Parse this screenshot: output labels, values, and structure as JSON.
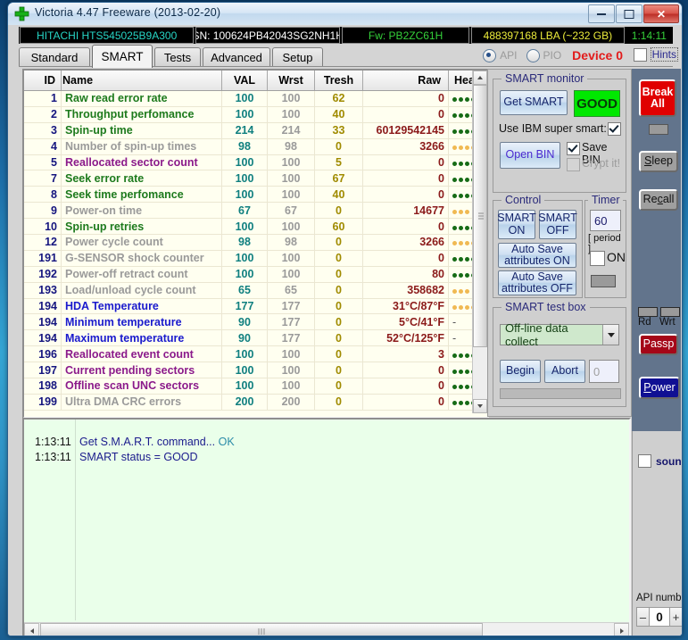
{
  "window": {
    "title": "Victoria 4.47  Freeware (2013-02-20)",
    "icon": "green-cross-icon",
    "minimize": "minimize-icon",
    "maximize": "maximize-icon",
    "close": "close-icon"
  },
  "drive_info": {
    "model": "HITACHI HTS545025B9A300",
    "serial": "SN: 100624PB42043SG2NH1H",
    "firmware": "Fw: PB2ZC61H",
    "capacity": "488397168 LBA (~232 GB)",
    "clock": "1:14:11"
  },
  "tabs": [
    {
      "label": "Standard",
      "active": false
    },
    {
      "label": "SMART",
      "active": true
    },
    {
      "label": "Tests",
      "active": false
    },
    {
      "label": "Advanced",
      "active": false
    },
    {
      "label": "Setup",
      "active": false
    }
  ],
  "mode": {
    "api_label": "API",
    "pio_label": "PIO",
    "api_selected": true,
    "pio_selected": false,
    "device_label": "Device 0",
    "device_color": "#e21b1b",
    "hints_label": "Hints",
    "hints_checked": false
  },
  "smart_table": {
    "headers": [
      "ID",
      "Name",
      "VAL",
      "Wrst",
      "Tresh",
      "Raw",
      "Health"
    ],
    "rows": [
      {
        "id": "1",
        "name": "Raw read error rate",
        "name_color": "green",
        "val": "100",
        "wrst": "100",
        "tresh": "62",
        "raw": "0",
        "raw_zero": true,
        "health": 5,
        "health_color": "green"
      },
      {
        "id": "2",
        "name": "Throughput perfomance",
        "name_color": "green",
        "val": "100",
        "wrst": "100",
        "tresh": "40",
        "raw": "0",
        "raw_zero": true,
        "health": 5,
        "health_color": "green"
      },
      {
        "id": "3",
        "name": "Spin-up time",
        "name_color": "green",
        "val": "214",
        "wrst": "214",
        "tresh": "33",
        "raw": "60129542145",
        "raw_zero": false,
        "health": 5,
        "health_color": "green"
      },
      {
        "id": "4",
        "name": "Number of spin-up times",
        "name_color": "gray",
        "val": "98",
        "wrst": "98",
        "tresh": "0",
        "raw": "3266",
        "raw_zero": false,
        "health": 4,
        "health_color": "orange"
      },
      {
        "id": "5",
        "name": "Reallocated sector count",
        "name_color": "purple",
        "val": "100",
        "wrst": "100",
        "tresh": "5",
        "raw": "0",
        "raw_zero": true,
        "health": 5,
        "health_color": "green"
      },
      {
        "id": "7",
        "name": "Seek error rate",
        "name_color": "green",
        "val": "100",
        "wrst": "100",
        "tresh": "67",
        "raw": "0",
        "raw_zero": true,
        "health": 5,
        "health_color": "green"
      },
      {
        "id": "8",
        "name": "Seek time perfomance",
        "name_color": "green",
        "val": "100",
        "wrst": "100",
        "tresh": "40",
        "raw": "0",
        "raw_zero": true,
        "health": 5,
        "health_color": "green"
      },
      {
        "id": "9",
        "name": "Power-on time",
        "name_color": "gray",
        "val": "67",
        "wrst": "67",
        "tresh": "0",
        "raw": "14677",
        "raw_zero": false,
        "health": 3,
        "health_color": "orange"
      },
      {
        "id": "10",
        "name": "Spin-up retries",
        "name_color": "green",
        "val": "100",
        "wrst": "100",
        "tresh": "60",
        "raw": "0",
        "raw_zero": true,
        "health": 5,
        "health_color": "green"
      },
      {
        "id": "12",
        "name": "Power cycle count",
        "name_color": "gray",
        "val": "98",
        "wrst": "98",
        "tresh": "0",
        "raw": "3266",
        "raw_zero": false,
        "health": 4,
        "health_color": "orange"
      },
      {
        "id": "191",
        "name": "G-SENSOR shock counter",
        "name_color": "gray",
        "val": "100",
        "wrst": "100",
        "tresh": "0",
        "raw": "0",
        "raw_zero": true,
        "health": 5,
        "health_color": "green"
      },
      {
        "id": "192",
        "name": "Power-off retract count",
        "name_color": "gray",
        "val": "100",
        "wrst": "100",
        "tresh": "0",
        "raw": "80",
        "raw_zero": false,
        "health": 5,
        "health_color": "green"
      },
      {
        "id": "193",
        "name": "Load/unload cycle count",
        "name_color": "gray",
        "val": "65",
        "wrst": "65",
        "tresh": "0",
        "raw": "358682",
        "raw_zero": false,
        "health": 3,
        "health_color": "orange"
      },
      {
        "id": "194",
        "name": "HDA Temperature",
        "name_color": "blue",
        "val": "177",
        "wrst": "177",
        "tresh": "0",
        "raw": "31°C/87°F",
        "raw_zero": false,
        "health": 4,
        "health_color": "orange"
      },
      {
        "id": "194",
        "name": "Minimum temperature",
        "name_color": "blue",
        "val": "90",
        "wrst": "177",
        "tresh": "0",
        "raw": "5°C/41°F",
        "raw_zero": false,
        "health": 0,
        "health_color": "dash"
      },
      {
        "id": "194",
        "name": "Maximum temperature",
        "name_color": "blue",
        "val": "90",
        "wrst": "177",
        "tresh": "0",
        "raw": "52°C/125°F",
        "raw_zero": false,
        "health": 0,
        "health_color": "dash"
      },
      {
        "id": "196",
        "name": "Reallocated event count",
        "name_color": "purple",
        "val": "100",
        "wrst": "100",
        "tresh": "0",
        "raw": "3",
        "raw_zero": false,
        "health": 5,
        "health_color": "green"
      },
      {
        "id": "197",
        "name": "Current pending sectors",
        "name_color": "purple",
        "val": "100",
        "wrst": "100",
        "tresh": "0",
        "raw": "0",
        "raw_zero": true,
        "health": 5,
        "health_color": "green"
      },
      {
        "id": "198",
        "name": "Offline scan UNC sectors",
        "name_color": "purple",
        "val": "100",
        "wrst": "100",
        "tresh": "0",
        "raw": "0",
        "raw_zero": true,
        "health": 5,
        "health_color": "green"
      },
      {
        "id": "199",
        "name": "Ultra DMA CRC errors",
        "name_color": "gray",
        "val": "200",
        "wrst": "200",
        "tresh": "0",
        "raw": "0",
        "raw_zero": true,
        "health": 5,
        "health_color": "green"
      }
    ]
  },
  "smart_monitor": {
    "group_label": "SMART monitor",
    "get_smart_label": "Get SMART",
    "status_value": "GOOD",
    "status_color": "#00e800",
    "ibm_label": "Use IBM super smart:",
    "ibm_checked": true,
    "open_bin_label": "Open BIN",
    "save_bin_label": "Save BIN",
    "save_bin_checked": true,
    "crypt_label": "Crypt it!",
    "crypt_checked": false,
    "crypt_enabled": false
  },
  "control": {
    "group_label": "Control",
    "smart_on_label": "SMART\nON",
    "smart_off_label": "SMART\nOFF",
    "autosave_on_label": "Auto Save\nattributes ON",
    "autosave_off_label": "Auto Save\nattributes OFF"
  },
  "timer": {
    "group_label": "Timer",
    "period_value": "60",
    "period_caption": "[ period ]",
    "on_label": "ON",
    "on_checked": false
  },
  "smart_test_box": {
    "group_label": "SMART test box",
    "selected_test": "Off-line data collect",
    "begin_label": "Begin",
    "abort_label": "Abort",
    "counter_value": "0",
    "progress_percent": 0
  },
  "side_buttons": {
    "break_all_label": "Break\nAll",
    "sleep_label": "Sleep",
    "recall_label": "Recall",
    "passp_label": "Passp",
    "power_label": "Power",
    "rd_label": "Rd",
    "wrt_label": "Wrt"
  },
  "log": {
    "lines": [
      {
        "time": "1:13:11",
        "message": "Get S.M.A.R.T. command... ",
        "suffix": "OK"
      },
      {
        "time": "1:13:11",
        "message": "SMART status = GOOD",
        "suffix": ""
      }
    ]
  },
  "bottom_right": {
    "sound_label": "sound",
    "sound_checked": false,
    "api_number_label": "API number",
    "api_number_value": "0",
    "minus_label": "–",
    "plus_label": "+"
  }
}
